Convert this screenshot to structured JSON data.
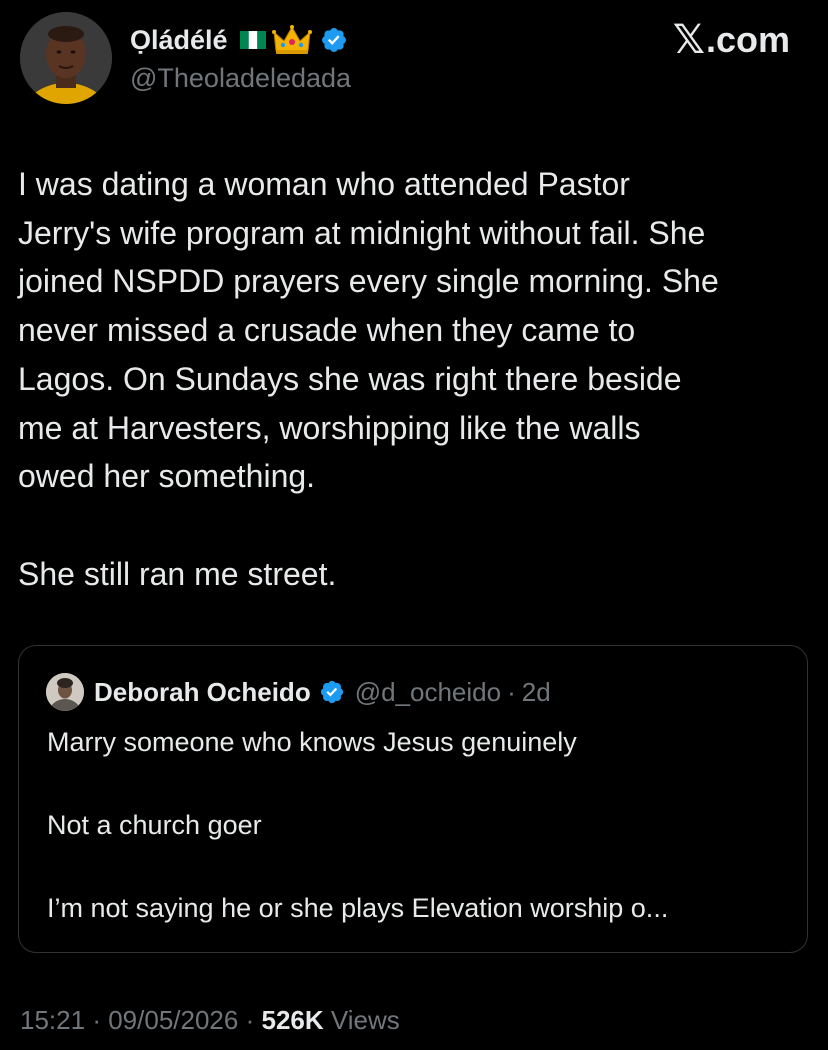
{
  "author": {
    "name": "Ọládélé",
    "handle": "@Theoladeledada",
    "flag_emoji": "nigeria-flag",
    "badge_emoji": "crown",
    "verified": true
  },
  "brand": {
    "x_glyph": "𝕏",
    "domain": ".com"
  },
  "tweet": {
    "paragraphs": [
      "I was dating a woman who attended Pastor\nJerry's wife program at midnight without fail. She\njoined NSPDD prayers every single morning. She\nnever missed a crusade when they came to\nLagos. On Sundays she was right there beside\nme at Harvesters, worshipping like the walls\nowed her something.",
      "She still ran me street."
    ]
  },
  "quote": {
    "name": "Deborah Ocheido",
    "handle": "@d_ocheido",
    "separator": "·",
    "time": "2d",
    "lines": [
      "Marry someone who knows Jesus genuinely",
      "Not a church goer",
      "I’m not saying he or she plays Elevation worship o..."
    ]
  },
  "meta": {
    "time": "15:21",
    "separator": "·",
    "date": "09/05/2026",
    "views_count": "526K",
    "views_label": "Views"
  },
  "colors": {
    "background": "#000000",
    "text_primary": "#e7e9ea",
    "text_secondary": "#71767b",
    "verified_blue": "#1d9bf0",
    "border": "#2f3336"
  },
  "icons": {
    "verified": "verified-badge-icon",
    "flag": "nigeria-flag-icon",
    "crown": "crown-icon",
    "brand": "x-logo-icon"
  }
}
